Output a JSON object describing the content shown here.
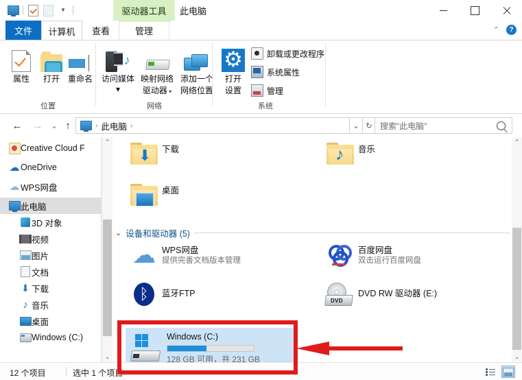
{
  "titlebar": {
    "quick_access": [
      "this-pc-icon",
      "properties-icon",
      "new-folder-icon",
      "customize-caret"
    ],
    "contextual_tab": "驱动器工具",
    "window_title": "此电脑",
    "minimize": "—",
    "maximize": "☐",
    "close": "✕"
  },
  "tabs": [
    {
      "label": "文件",
      "name": "tab-file"
    },
    {
      "label": "计算机",
      "name": "tab-computer"
    },
    {
      "label": "查看",
      "name": "tab-view"
    },
    {
      "label": "管理",
      "name": "tab-manage"
    }
  ],
  "ribbon": {
    "collapse_caret": "⌃",
    "help": "?",
    "groups": [
      {
        "label": "位置",
        "buttons": [
          {
            "label": "属性",
            "icon": "properties-icon"
          },
          {
            "label": "打开",
            "icon": "open-folder-icon"
          },
          {
            "label": "重命名",
            "icon": "rename-icon"
          }
        ]
      },
      {
        "label": "网络",
        "buttons": [
          {
            "label_line1": "访问媒体",
            "label_line2": "",
            "icon": "access-media-icon",
            "has_caret": true
          },
          {
            "label_line1": "映射网络",
            "label_line2": "驱动器",
            "icon": "map-network-drive-icon",
            "has_caret": true
          },
          {
            "label_line1": "添加一个",
            "label_line2": "网络位置",
            "icon": "add-network-location-icon",
            "has_caret": false
          }
        ]
      },
      {
        "label": "系统",
        "big_button": {
          "label_line1": "打开",
          "label_line2": "设置",
          "icon": "settings-gear-icon"
        },
        "small_buttons": [
          {
            "label": "卸载或更改程序",
            "icon": "uninstall-program-icon"
          },
          {
            "label": "系统属性",
            "icon": "system-properties-icon"
          },
          {
            "label": "管理",
            "icon": "manage-icon"
          }
        ]
      }
    ]
  },
  "addressbar": {
    "back": "←",
    "forward": "→",
    "recent": "⌄",
    "up": "↑",
    "breadcrumb_icon": "this-pc-icon",
    "breadcrumb_text": "此电脑",
    "breadcrumb_sep": "›",
    "dropdown": "⌄",
    "refresh": "↻",
    "search_placeholder": "搜索\"此电脑\"",
    "search_icon": "search-icon"
  },
  "navpane": {
    "items": [
      {
        "label": "Creative Cloud F",
        "icon": "creative-cloud-icon",
        "indent": 0,
        "selected": false
      },
      {
        "label": "OneDrive",
        "icon": "onedrive-icon",
        "indent": 0,
        "selected": false
      },
      {
        "label": "WPS网盘",
        "icon": "wps-cloud-icon",
        "indent": 0,
        "selected": false
      },
      {
        "label": "此电脑",
        "icon": "this-pc-icon",
        "indent": 0,
        "selected": true
      },
      {
        "label": "3D 对象",
        "icon": "3d-objects-icon",
        "indent": 1,
        "selected": false
      },
      {
        "label": "视频",
        "icon": "videos-icon",
        "indent": 1,
        "selected": false
      },
      {
        "label": "图片",
        "icon": "pictures-icon",
        "indent": 1,
        "selected": false
      },
      {
        "label": "文档",
        "icon": "documents-icon",
        "indent": 1,
        "selected": false
      },
      {
        "label": "下载",
        "icon": "downloads-icon",
        "indent": 1,
        "selected": false
      },
      {
        "label": "音乐",
        "icon": "music-icon",
        "indent": 1,
        "selected": false
      },
      {
        "label": "桌面",
        "icon": "desktop-icon",
        "indent": 1,
        "selected": false
      },
      {
        "label": "Windows (C:)",
        "icon": "hard-drive-icon",
        "indent": 1,
        "selected": false
      }
    ],
    "scroll_up": "⌃",
    "scroll_down": "⌄"
  },
  "content": {
    "folders": [
      {
        "name": "下载",
        "icon": "downloads-folder-icon"
      },
      {
        "name": "音乐",
        "icon": "music-folder-icon"
      },
      {
        "name": "桌面",
        "icon": "desktop-folder-icon"
      }
    ],
    "group_header": {
      "caret": "⌄",
      "label": "设备和驱动器 (5)"
    },
    "devices": [
      {
        "name": "WPS网盘",
        "sub": "提供完善文档版本管理",
        "icon": "wps-cloud-icon"
      },
      {
        "name": "百度网盘",
        "sub": "双击运行百度网盘",
        "icon": "baidu-netdisk-icon"
      },
      {
        "name": "蓝牙FTP",
        "sub": "",
        "icon": "bluetooth-icon"
      },
      {
        "name": "DVD RW 驱动器 (E:)",
        "sub": "",
        "icon": "dvd-drive-icon"
      }
    ],
    "selected_drive": {
      "name": "Windows (C:)",
      "sub": "128 GB 可用，共 231 GB",
      "icon": "windows-drive-icon",
      "used_percent": 45,
      "free_gb": 128,
      "total_gb": 231
    },
    "scroll_up": "⌃",
    "scroll_down": "⌄"
  },
  "statusbar": {
    "item_count": "12 个项目",
    "selection": "选中 1 个项目",
    "view_details_icon": "details-view-icon",
    "view_thumbnails_icon": "large-icons-view-icon"
  },
  "annotation": {
    "box_color": "#e01b1b",
    "arrow_color": "#e01b1b"
  }
}
